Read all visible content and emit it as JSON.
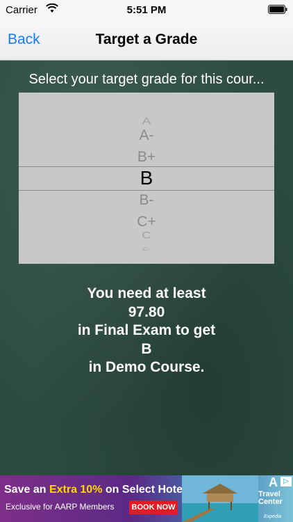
{
  "status_bar": {
    "carrier": "Carrier",
    "time": "5:51 PM"
  },
  "nav": {
    "back_label": "Back",
    "title": "Target a Grade"
  },
  "prompt": "Select your target grade for this cour...",
  "picker": {
    "options": [
      "A",
      "A-",
      "B+",
      "B",
      "B-",
      "C+",
      "C",
      "C-"
    ],
    "selected": "B"
  },
  "result": {
    "line1": "You need at least",
    "score": "97.80",
    "line3": "in Final Exam to get",
    "grade": "B",
    "line5": "in Demo Course."
  },
  "ad": {
    "headline_prefix": "Save an ",
    "headline_highlight": "Extra 10%",
    "headline_suffix": " on Select Hotels!",
    "subline": "Exclusive for AARP Members",
    "button_label": "BOOK NOW",
    "brand_line1": "Travel",
    "brand_line2": "Center",
    "brand_partner": "Expedia",
    "corner_mark": "A",
    "accent_color": "#e21c23"
  }
}
